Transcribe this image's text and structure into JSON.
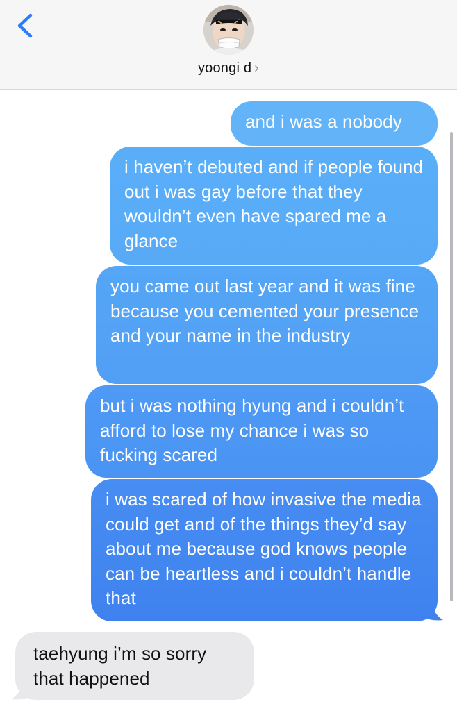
{
  "header": {
    "contact_name": "yoongi d",
    "chevron": "›"
  },
  "icons": {
    "back": "chevron-left-icon",
    "avatar": "contact-avatar"
  },
  "colors": {
    "accent": "#2f7cf6",
    "outgoing_top": "#62b3f8",
    "outgoing_bottom": "#3f82ef",
    "incoming": "#e9e9eb"
  },
  "messages": [
    {
      "direction": "outgoing",
      "text": "and i was a nobody"
    },
    {
      "direction": "outgoing",
      "text": "i haven’t debuted and if people found out i was gay before that they wouldn’t even have spared me a glance"
    },
    {
      "direction": "outgoing",
      "text": "you came out last year and it was fine because you cemented your presence and your name in the industry"
    },
    {
      "direction": "outgoing",
      "text": "but i was nothing hyung and i couldn’t afford to lose my chance i was so fucking scared"
    },
    {
      "direction": "outgoing",
      "text": "i was scared of how invasive the media could get and of the things they’d say about me because god knows people can be heartless and i couldn’t handle that"
    },
    {
      "direction": "incoming",
      "text": "taehyung i’m so sorry that happened"
    }
  ]
}
